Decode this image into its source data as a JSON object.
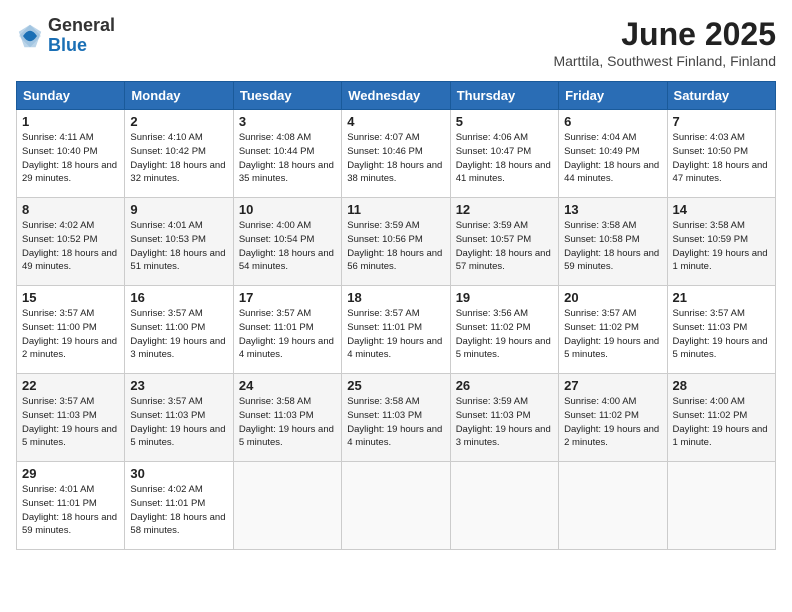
{
  "header": {
    "logo": {
      "general": "General",
      "blue": "Blue"
    },
    "title": "June 2025",
    "subtitle": "Marttila, Southwest Finland, Finland"
  },
  "days_of_week": [
    "Sunday",
    "Monday",
    "Tuesday",
    "Wednesday",
    "Thursday",
    "Friday",
    "Saturday"
  ],
  "weeks": [
    [
      {
        "day": 1,
        "sunrise": "4:11 AM",
        "sunset": "10:40 PM",
        "daylight": "18 hours and 29 minutes."
      },
      {
        "day": 2,
        "sunrise": "4:10 AM",
        "sunset": "10:42 PM",
        "daylight": "18 hours and 32 minutes."
      },
      {
        "day": 3,
        "sunrise": "4:08 AM",
        "sunset": "10:44 PM",
        "daylight": "18 hours and 35 minutes."
      },
      {
        "day": 4,
        "sunrise": "4:07 AM",
        "sunset": "10:46 PM",
        "daylight": "18 hours and 38 minutes."
      },
      {
        "day": 5,
        "sunrise": "4:06 AM",
        "sunset": "10:47 PM",
        "daylight": "18 hours and 41 minutes."
      },
      {
        "day": 6,
        "sunrise": "4:04 AM",
        "sunset": "10:49 PM",
        "daylight": "18 hours and 44 minutes."
      },
      {
        "day": 7,
        "sunrise": "4:03 AM",
        "sunset": "10:50 PM",
        "daylight": "18 hours and 47 minutes."
      }
    ],
    [
      {
        "day": 8,
        "sunrise": "4:02 AM",
        "sunset": "10:52 PM",
        "daylight": "18 hours and 49 minutes."
      },
      {
        "day": 9,
        "sunrise": "4:01 AM",
        "sunset": "10:53 PM",
        "daylight": "18 hours and 51 minutes."
      },
      {
        "day": 10,
        "sunrise": "4:00 AM",
        "sunset": "10:54 PM",
        "daylight": "18 hours and 54 minutes."
      },
      {
        "day": 11,
        "sunrise": "3:59 AM",
        "sunset": "10:56 PM",
        "daylight": "18 hours and 56 minutes."
      },
      {
        "day": 12,
        "sunrise": "3:59 AM",
        "sunset": "10:57 PM",
        "daylight": "18 hours and 57 minutes."
      },
      {
        "day": 13,
        "sunrise": "3:58 AM",
        "sunset": "10:58 PM",
        "daylight": "18 hours and 59 minutes."
      },
      {
        "day": 14,
        "sunrise": "3:58 AM",
        "sunset": "10:59 PM",
        "daylight": "19 hours and 1 minute."
      }
    ],
    [
      {
        "day": 15,
        "sunrise": "3:57 AM",
        "sunset": "11:00 PM",
        "daylight": "19 hours and 2 minutes."
      },
      {
        "day": 16,
        "sunrise": "3:57 AM",
        "sunset": "11:00 PM",
        "daylight": "19 hours and 3 minutes."
      },
      {
        "day": 17,
        "sunrise": "3:57 AM",
        "sunset": "11:01 PM",
        "daylight": "19 hours and 4 minutes."
      },
      {
        "day": 18,
        "sunrise": "3:57 AM",
        "sunset": "11:01 PM",
        "daylight": "19 hours and 4 minutes."
      },
      {
        "day": 19,
        "sunrise": "3:56 AM",
        "sunset": "11:02 PM",
        "daylight": "19 hours and 5 minutes."
      },
      {
        "day": 20,
        "sunrise": "3:57 AM",
        "sunset": "11:02 PM",
        "daylight": "19 hours and 5 minutes."
      },
      {
        "day": 21,
        "sunrise": "3:57 AM",
        "sunset": "11:03 PM",
        "daylight": "19 hours and 5 minutes."
      }
    ],
    [
      {
        "day": 22,
        "sunrise": "3:57 AM",
        "sunset": "11:03 PM",
        "daylight": "19 hours and 5 minutes."
      },
      {
        "day": 23,
        "sunrise": "3:57 AM",
        "sunset": "11:03 PM",
        "daylight": "19 hours and 5 minutes."
      },
      {
        "day": 24,
        "sunrise": "3:58 AM",
        "sunset": "11:03 PM",
        "daylight": "19 hours and 5 minutes."
      },
      {
        "day": 25,
        "sunrise": "3:58 AM",
        "sunset": "11:03 PM",
        "daylight": "19 hours and 4 minutes."
      },
      {
        "day": 26,
        "sunrise": "3:59 AM",
        "sunset": "11:03 PM",
        "daylight": "19 hours and 3 minutes."
      },
      {
        "day": 27,
        "sunrise": "4:00 AM",
        "sunset": "11:02 PM",
        "daylight": "19 hours and 2 minutes."
      },
      {
        "day": 28,
        "sunrise": "4:00 AM",
        "sunset": "11:02 PM",
        "daylight": "19 hours and 1 minute."
      }
    ],
    [
      {
        "day": 29,
        "sunrise": "4:01 AM",
        "sunset": "11:01 PM",
        "daylight": "18 hours and 59 minutes."
      },
      {
        "day": 30,
        "sunrise": "4:02 AM",
        "sunset": "11:01 PM",
        "daylight": "18 hours and 58 minutes."
      },
      null,
      null,
      null,
      null,
      null
    ]
  ]
}
